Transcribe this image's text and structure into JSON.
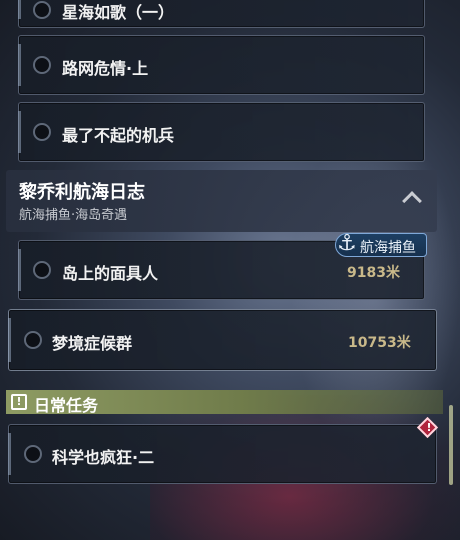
{
  "quests_above": [
    {
      "label": "星海如歌（一）"
    },
    {
      "label": "路网危情·上"
    },
    {
      "label": "最了不起的机兵"
    }
  ],
  "chapter": {
    "title": "黎乔利航海日志",
    "subtitle": "航海捕鱼·海岛奇遇",
    "expand_icon": "chevron-up-icon"
  },
  "chapter_quests": [
    {
      "label": "岛上的面具人",
      "distance": "9183米",
      "tag": "航海捕鱼"
    },
    {
      "label": "梦境症候群",
      "distance": "10753米"
    }
  ],
  "daily_section": {
    "title": "日常任务",
    "icon": "exclamation-icon"
  },
  "daily_quests": [
    {
      "label": "科学也疯狂·二",
      "marker": "!"
    }
  ],
  "colors": {
    "daily_header": "#8e9b63",
    "distance_text": "#c9b98a",
    "badge_bg": "#1d3f63",
    "diamond": "#b0243d"
  }
}
